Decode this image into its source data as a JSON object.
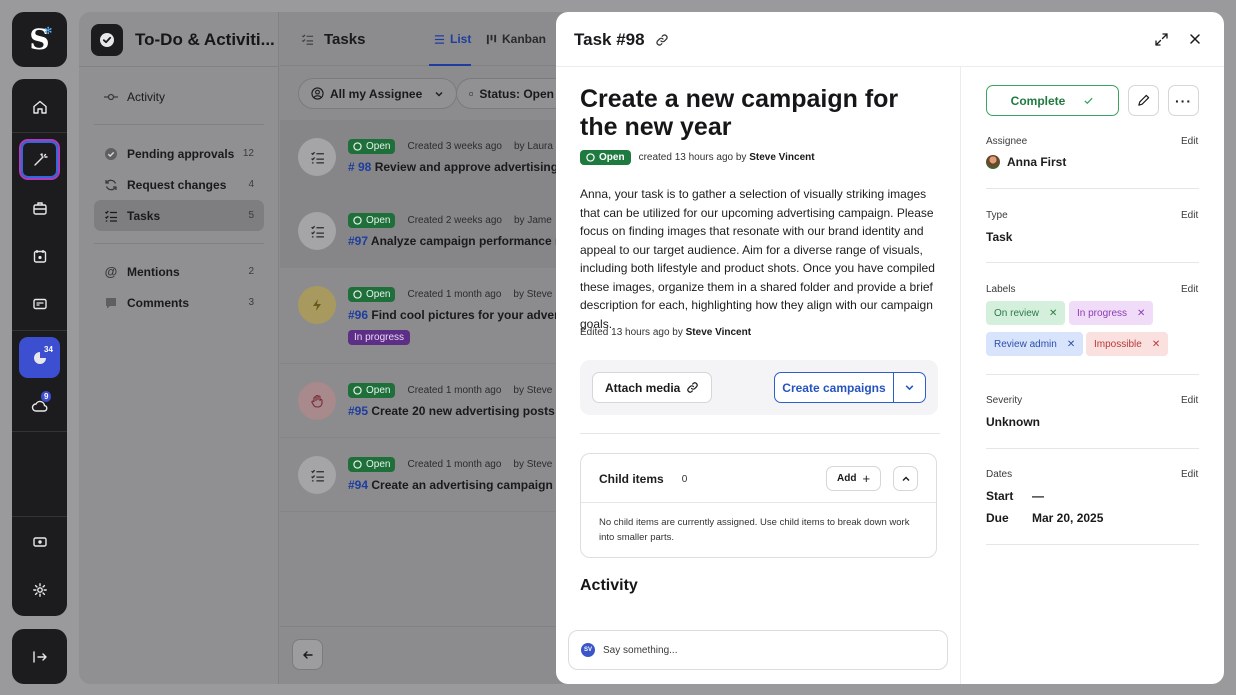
{
  "rail": {
    "logo_letter": "S",
    "badges": {
      "analytics": "34",
      "cloud": "9"
    }
  },
  "sidebar": {
    "app_title": "To-Do & Activiti...",
    "items": [
      {
        "label": "Activity",
        "count": ""
      },
      {
        "label": "Pending approvals",
        "count": "12"
      },
      {
        "label": "Request changes",
        "count": "4"
      },
      {
        "label": "Tasks",
        "count": "5"
      },
      {
        "label": "Mentions",
        "count": "2"
      },
      {
        "label": "Comments",
        "count": "3"
      }
    ]
  },
  "main": {
    "title": "Tasks",
    "tabs": [
      {
        "label": "List"
      },
      {
        "label": "Kanban"
      }
    ],
    "filters": {
      "assignee": "All my Assignee",
      "status": "Status: Open"
    },
    "rows": [
      {
        "status": "Open",
        "created": "Created 3 weeks ago",
        "by": "by  Laura",
        "num": "# 98",
        "title": "Review and approve advertising co",
        "label": ""
      },
      {
        "status": "Open",
        "created": "Created 2 weeks ago",
        "by": "by  Jame",
        "num": "#97",
        "title": "Analyze campaign performance me",
        "label": ""
      },
      {
        "status": "Open",
        "created": "Created 1 month ago",
        "by": "by  Steve",
        "num": "#96",
        "title": "Find cool pictures for your advertisi",
        "label": "In progress"
      },
      {
        "status": "Open",
        "created": "Created 1 month ago",
        "by": "by  Steve",
        "num": "#95",
        "title": "Create 20 new advertising posts",
        "label": ""
      },
      {
        "status": "Open",
        "created": "Created 1 month ago",
        "by": "by  Steve",
        "num": "#94",
        "title": "Create an advertising campaign",
        "label": ""
      }
    ]
  },
  "modal": {
    "header_title": "Task #98",
    "task_title": "Create a new campaign for the new year",
    "status": "Open",
    "created_meta": "created 13 hours ago by",
    "created_by": "Steve Vincent",
    "description": "Anna, your task is to gather a selection of visually striking images that can be utilized for our upcoming advertising campaign. Please focus on finding images that resonate with our brand identity and appeal to our target audience. Aim for a diverse range of visuals, including both lifestyle and product shots. Once you have compiled these images, organize them in a shared folder and provide a brief description for each, highlighting how they align with our campaign goals.",
    "edited_meta": "Edited 13 hours ago by",
    "edited_by": "Steve Vincent",
    "attach_label": "Attach media",
    "create_label": "Create campaigns",
    "child": {
      "title": "Child items",
      "count": "0",
      "add_label": "Add",
      "empty_text": "No child items are currently assigned. Use child items to break down work into smaller parts."
    },
    "activity_title": "Activity",
    "comment_placeholder": "Say something...",
    "comment_avatar": "SV"
  },
  "details": {
    "complete_label": "Complete",
    "edit_label": "Edit",
    "assignee": {
      "label": "Assignee",
      "value": "Anna First"
    },
    "type": {
      "label": "Type",
      "value": "Task"
    },
    "labels": {
      "label": "Labels",
      "items": [
        {
          "text": "On review",
          "bg": "#d4f0dd",
          "fg": "#2d7a48"
        },
        {
          "text": "In progress",
          "bg": "#f0dcf8",
          "fg": "#8a3fb0"
        },
        {
          "text": "Review admin",
          "bg": "#d8e4fb",
          "fg": "#2b4fae"
        },
        {
          "text": "Impossible",
          "bg": "#fbe0e0",
          "fg": "#b53a3a"
        }
      ]
    },
    "severity": {
      "label": "Severity",
      "value": "Unknown"
    },
    "dates": {
      "label": "Dates",
      "start_label": "Start",
      "start_value": "—",
      "due_label": "Due",
      "due_value": "Mar 20, 2025"
    }
  }
}
